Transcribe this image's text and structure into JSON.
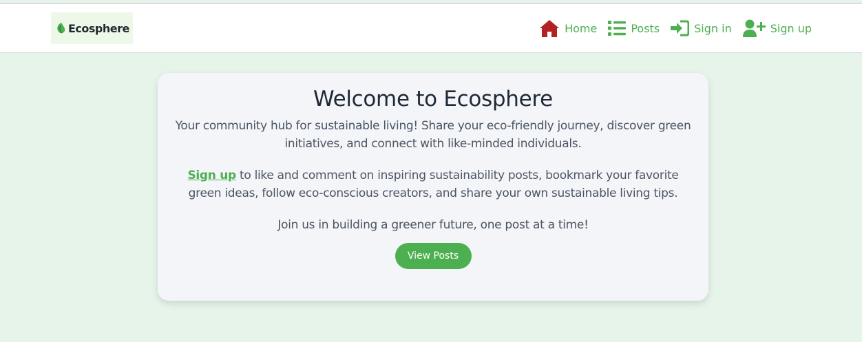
{
  "brand": {
    "name": "Ecosphere",
    "logo_icon": "leaf-icon"
  },
  "nav": {
    "items": [
      {
        "label": "Home",
        "icon": "home-icon"
      },
      {
        "label": "Posts",
        "icon": "list-icon"
      },
      {
        "label": "Sign in",
        "icon": "sign-in-icon"
      },
      {
        "label": "Sign up",
        "icon": "user-plus-icon"
      }
    ]
  },
  "hero": {
    "title": "Welcome to Ecosphere",
    "intro": "Your community hub for sustainable living! Share your eco-friendly journey, discover green initiatives, and connect with like-minded individuals.",
    "signup_link": "Sign up",
    "signup_text": " to like and comment on inspiring sustainability posts, bookmark your favorite green ideas, follow eco-conscious creators, and share your own sustainable living tips.",
    "closing": "Join us in building a greener future, one post at a time!",
    "cta_label": "View Posts"
  },
  "colors": {
    "accent": "#4caf50",
    "home_icon": "#b22222",
    "page_background": "#e6f4ea",
    "card_background": "#f3f5f8"
  }
}
